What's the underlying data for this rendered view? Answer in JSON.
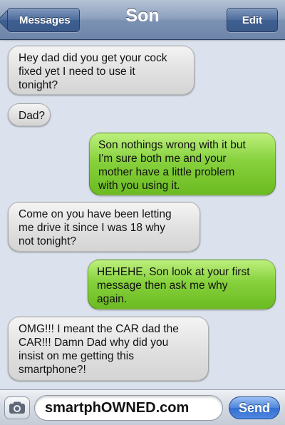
{
  "header": {
    "title": "Son",
    "back_label": "Messages",
    "edit_label": "Edit"
  },
  "messages": [
    {
      "direction": "incoming",
      "text": "Hey dad did you get your cock\nfixed yet I need to use it\ntonight?"
    },
    {
      "direction": "incoming",
      "text": "Dad?"
    },
    {
      "direction": "outgoing",
      "text": "Son nothings wrong with it but\nI'm sure both me and your\nmother have a little problem\nwith you using it."
    },
    {
      "direction": "incoming",
      "text": "Come on you have been letting\nme drive it since I was 18 why\nnot tonight?"
    },
    {
      "direction": "outgoing",
      "text": "HEHEHE, Son look at your first\nmessage then ask me why\nagain."
    },
    {
      "direction": "incoming",
      "text": "OMG!!! I meant the CAR dad the\nCAR!!! Damn Dad why did you\ninsist on me getting this\nsmartphone?!"
    }
  ],
  "composer": {
    "input_value": "smartphOWNED.com",
    "send_label": "Send",
    "camera_icon": "camera-icon"
  },
  "colors": {
    "incoming_bubble": "#e3e3e3",
    "outgoing_bubble": "#86d13c",
    "background": "#dbe2ed",
    "nav_bar": "#7c92b3",
    "send_button": "#356fd1"
  }
}
